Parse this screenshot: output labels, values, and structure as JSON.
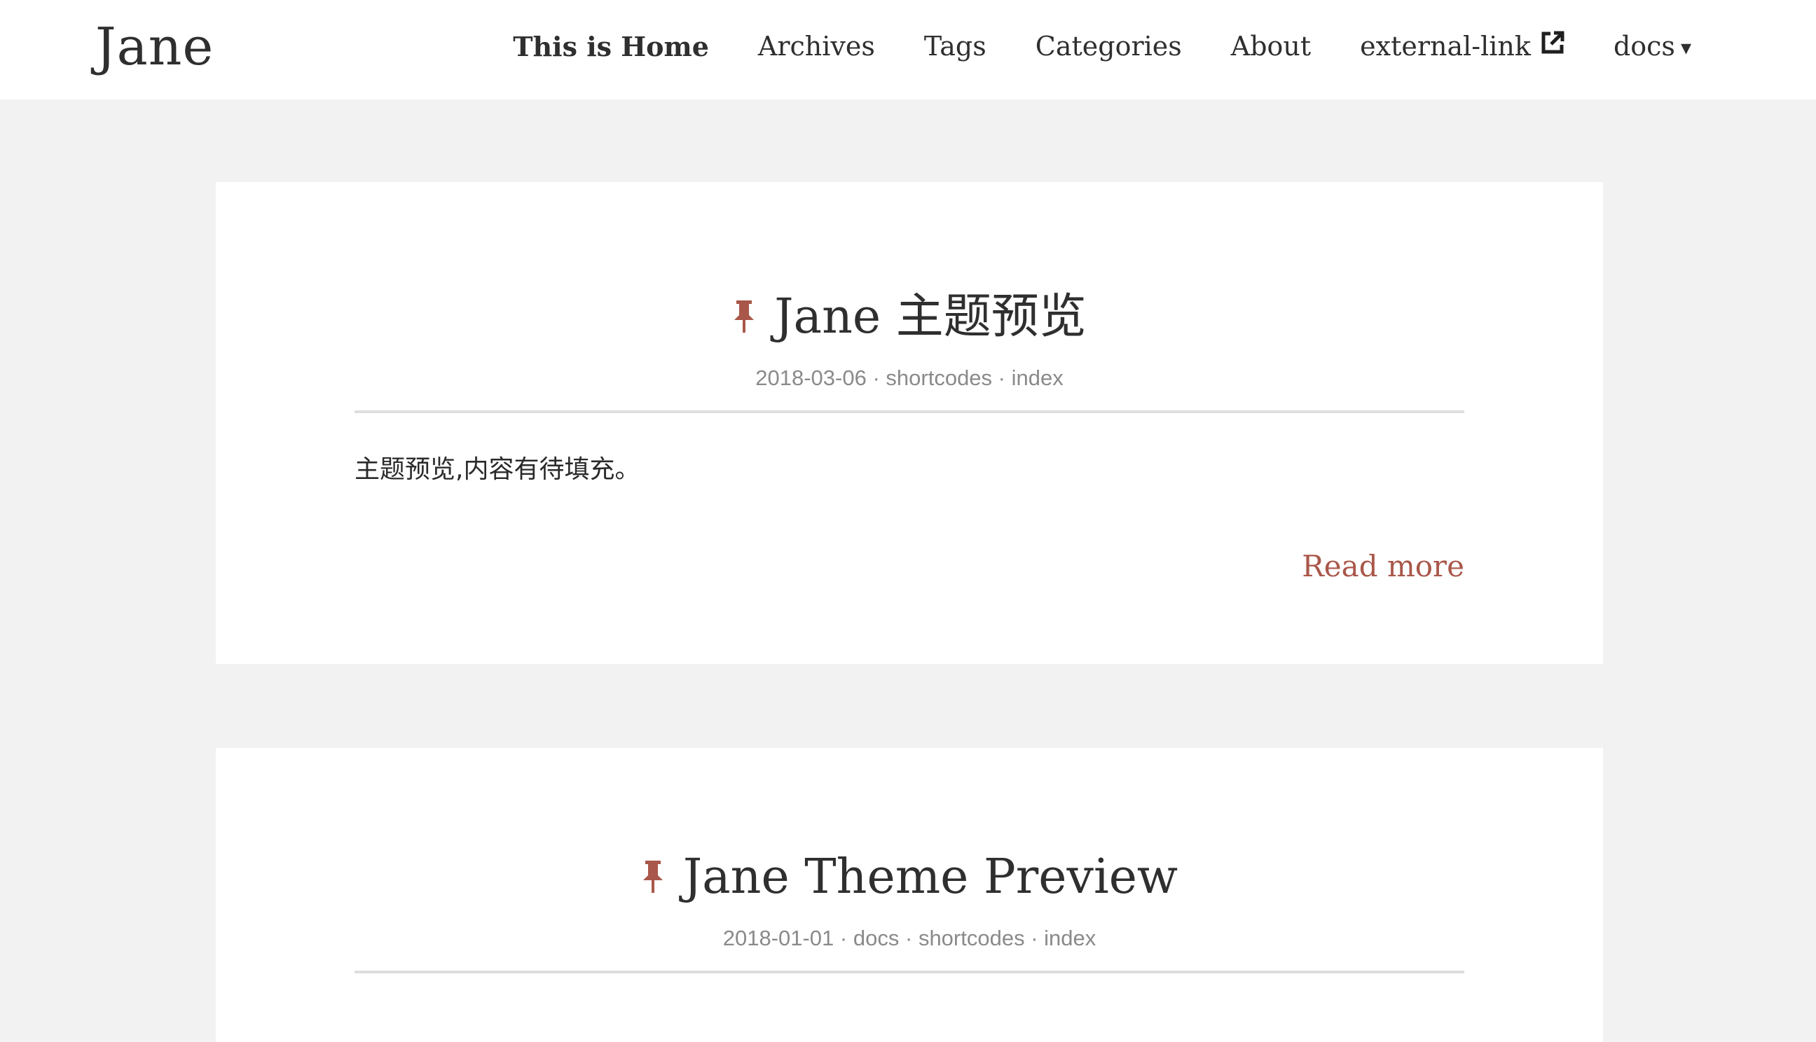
{
  "site": {
    "logo": "Jane"
  },
  "nav": {
    "items": [
      {
        "label": "This is Home"
      },
      {
        "label": "Archives"
      },
      {
        "label": "Tags"
      },
      {
        "label": "Categories"
      },
      {
        "label": "About"
      },
      {
        "label": "external-link"
      },
      {
        "label": "docs"
      }
    ],
    "external_icon": "external-link-icon",
    "dropdown_icon": "caret-down-icon",
    "caret_glyph": "▾"
  },
  "posts": [
    {
      "pinned": true,
      "pin_icon": "pin-icon",
      "title": "Jane 主题预览",
      "date": "2018-03-06",
      "categories": [
        "shortcodes",
        "index"
      ],
      "summary": "主题预览,内容有待填充。",
      "read_more": "Read more"
    },
    {
      "pinned": true,
      "pin_icon": "pin-icon",
      "title": "Jane Theme Preview",
      "date": "2018-01-01",
      "categories": [
        "docs",
        "shortcodes",
        "index"
      ]
    }
  ],
  "meta_separator": "·",
  "colors": {
    "accent": "#a9574a",
    "page_background": "#f2f2f3",
    "card_background": "#ffffff",
    "meta_text": "#8a8a8a",
    "text": "#2f2f2f"
  }
}
